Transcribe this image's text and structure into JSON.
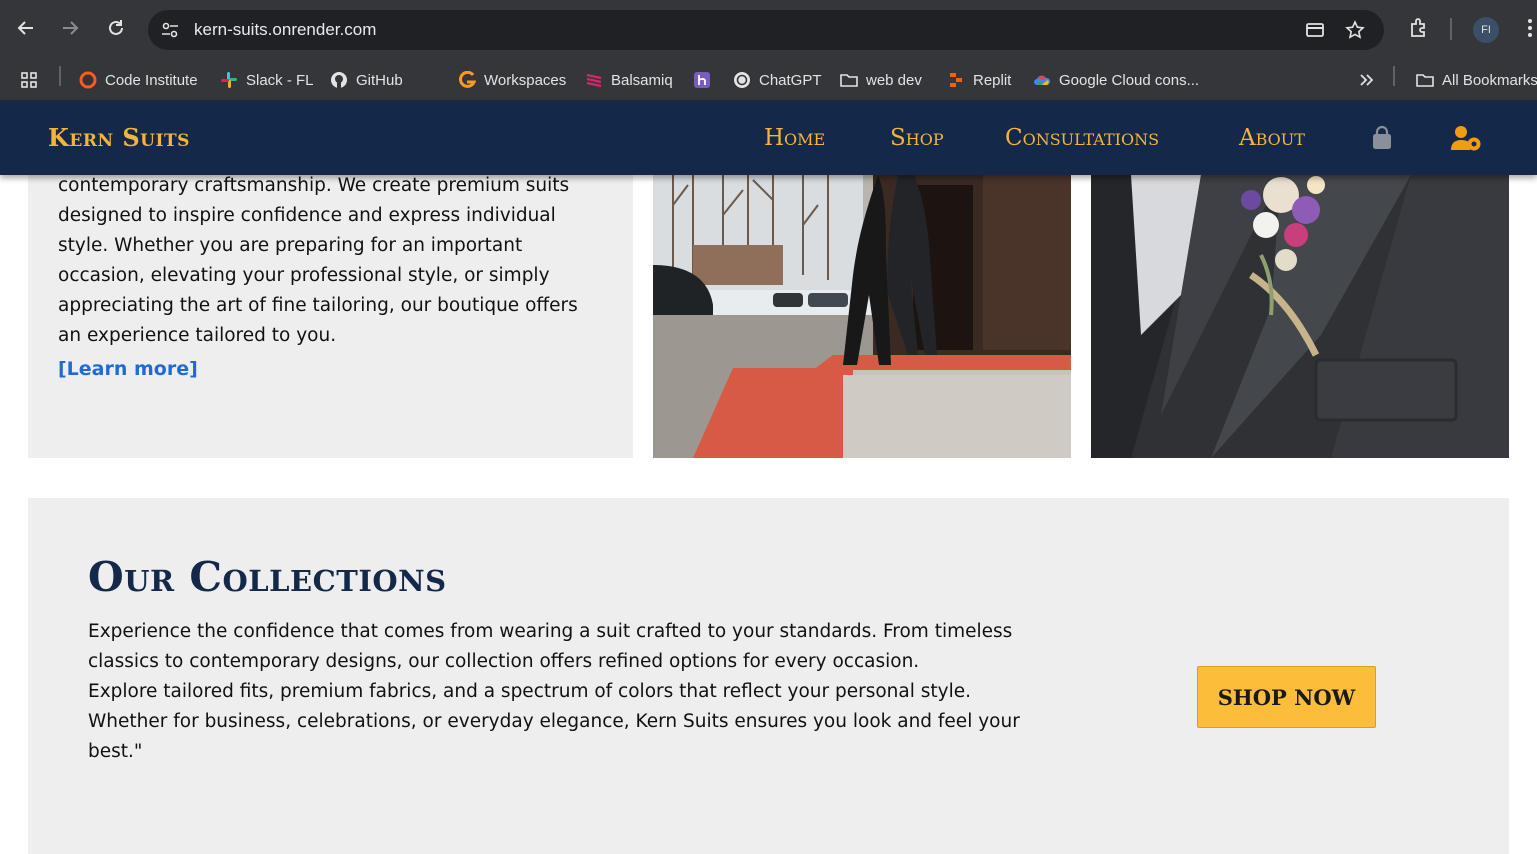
{
  "browser": {
    "url": "kern-suits.onrender.com",
    "profile_initials": "FI",
    "bookmarks": [
      {
        "label": "Code Institute",
        "icon": "code-institute-icon"
      },
      {
        "label": "Slack - FL",
        "icon": "slack-icon"
      },
      {
        "label": "GitHub",
        "icon": "github-icon"
      },
      {
        "label": "Workspaces",
        "icon": "workspaces-icon"
      },
      {
        "label": "Balsamiq",
        "icon": "balsamiq-icon"
      },
      {
        "label": "",
        "icon": "heroku-icon"
      },
      {
        "label": "ChatGPT",
        "icon": "chatgpt-icon"
      },
      {
        "label": "web dev",
        "icon": "folder-icon"
      },
      {
        "label": "Replit",
        "icon": "replit-icon"
      },
      {
        "label": "Google Cloud cons...",
        "icon": "google-cloud-icon"
      }
    ],
    "all_bookmarks_label": "All Bookmarks"
  },
  "site": {
    "brand": "Kern Suits",
    "brand_color": "#f4b33b",
    "nav_color": "#14294a",
    "menu": [
      "Home",
      "Shop",
      "Consultations",
      "About"
    ],
    "icons": [
      "shopping-bag-icon",
      "user-gear-icon"
    ]
  },
  "intro": {
    "text": "contemporary craftsmanship. We create premium suits designed to inspire confidence and express individual style. Whether you are preparing for an important occasion, elevating your professional style, or simply appreciating the art of fine tailoring, our boutique offers an experience tailored to you.",
    "learn_more": "[Learn more]"
  },
  "collections": {
    "title": "Our Collections",
    "paragraph1": "Experience the confidence that comes from wearing a suit crafted to your standards. From timeless classics to contemporary designs, our collection offers refined options for every occasion.",
    "paragraph2": "Explore tailored fits, premium fabrics, and a spectrum of colors that reflect your personal style. Whether for business, celebrations, or everyday elegance, Kern Suits ensures you look and feel your best.\"",
    "cta": "SHOP NOW",
    "cta_color": "#fbbd3a"
  }
}
